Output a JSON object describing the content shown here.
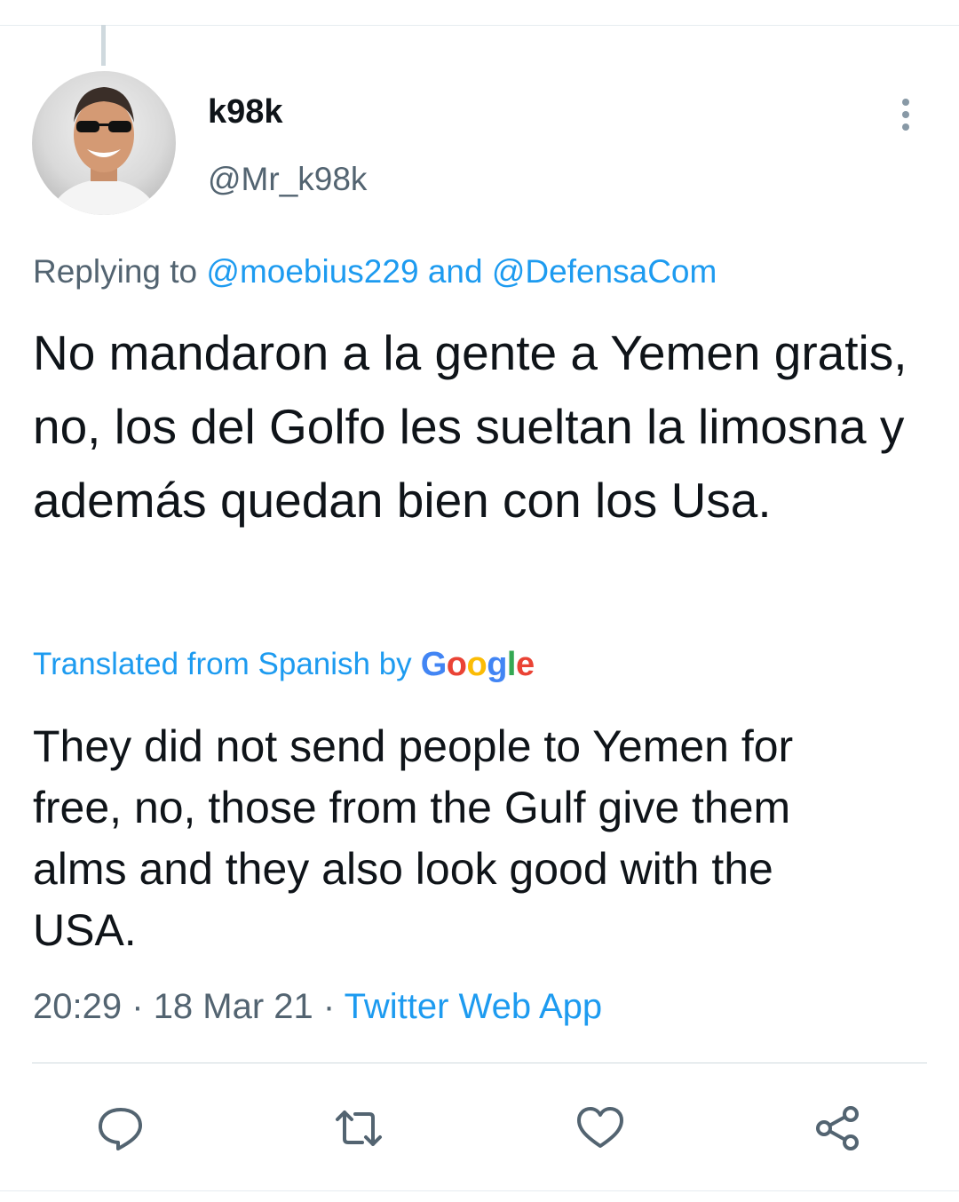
{
  "user": {
    "display_name": "k98k",
    "handle": "@Mr_k98k"
  },
  "reply_context": {
    "prefix": "Replying to",
    "mention_1": "@moebius229",
    "conjunction": "and",
    "mention_2": "@DefensaCom"
  },
  "tweet": {
    "text": "No mandaron a la gente a Yemen gratis, no, los del Golfo les sueltan la limosna y además quedan bien con los Usa.",
    "translated_label": "Translated from Spanish by",
    "translation_provider": "Google",
    "translation": "They did not send people to Yemen for free, no, those from the Gulf give them alms and they also look good with the USA.",
    "time": "20:29",
    "separator": "·",
    "date": "18 Mar 21",
    "source": "Twitter Web App"
  },
  "icons": {
    "more": "more-vertical-icon",
    "reply": "reply-icon",
    "retweet": "retweet-icon",
    "like": "heart-icon",
    "share": "share-icon"
  },
  "colors": {
    "link": "#1d9bf0",
    "secondary_text": "#536471",
    "icon": "#536471"
  }
}
